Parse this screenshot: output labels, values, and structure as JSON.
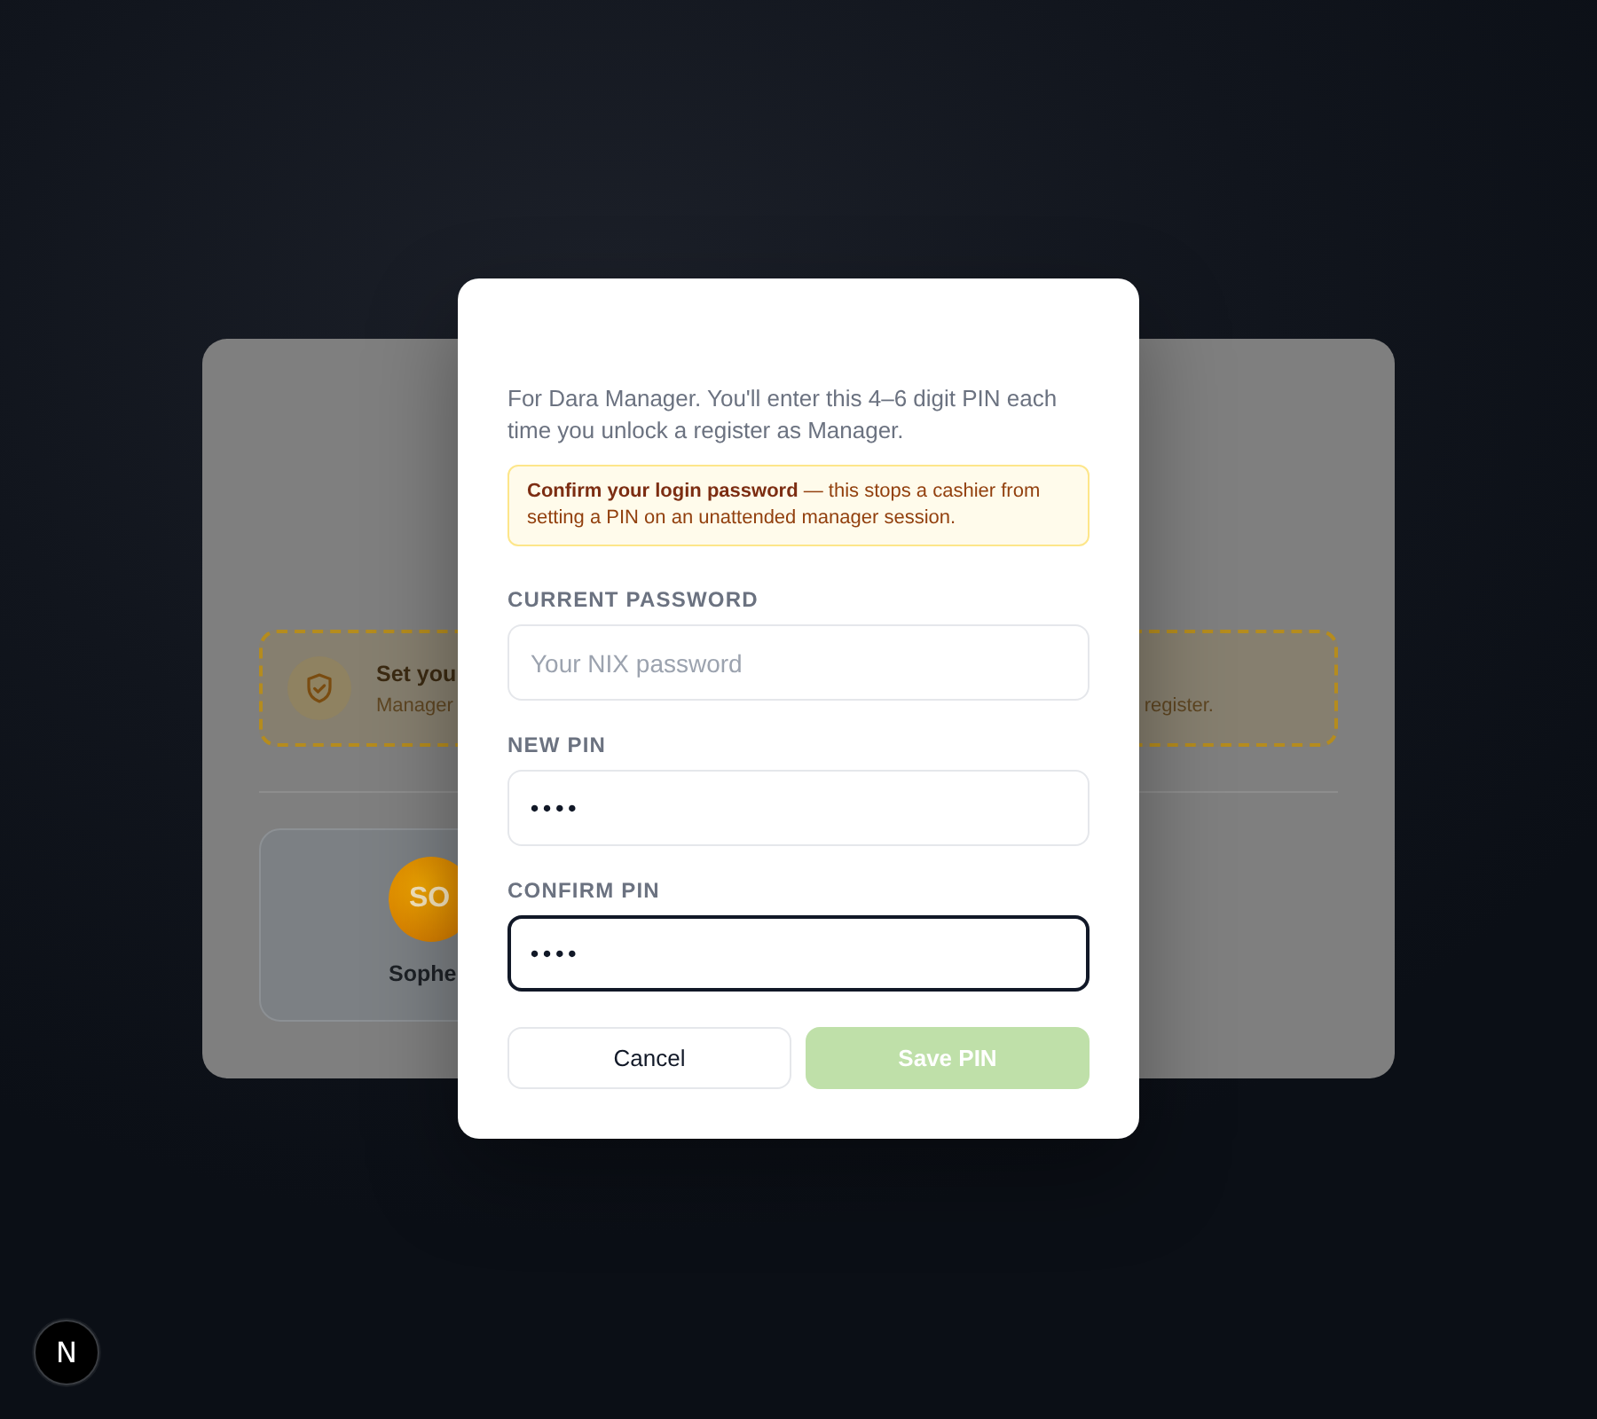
{
  "background_card": {
    "banner": {
      "title": "Set you",
      "subtitle": "Manager",
      "subtitle_end": "register."
    },
    "staff": [
      {
        "initials": "SO",
        "name": "Sophe"
      }
    ]
  },
  "dialog": {
    "description": "For Dara Manager. You'll enter this 4–6 digit PIN each time you unlock a register as Manager.",
    "notice": "**Confirm your login password** — this stops a cashier from setting a PIN on an unattended manager session.",
    "fields": [
      {
        "label": "CURRENT PASSWORD",
        "placeholder": "Your NIX password",
        "focused": false
      },
      {
        "label": "NEW PIN",
        "value": "••••",
        "focused": false
      },
      {
        "label": "CONFIRM PIN",
        "value": "••••",
        "focused": true
      }
    ],
    "buttons": [
      {
        "label": "Cancel",
        "kind": "secondary",
        "disabled": false
      },
      {
        "label": "Save PIN",
        "kind": "primary",
        "disabled": true
      }
    ]
  },
  "dev_badge": {
    "label": "N"
  }
}
